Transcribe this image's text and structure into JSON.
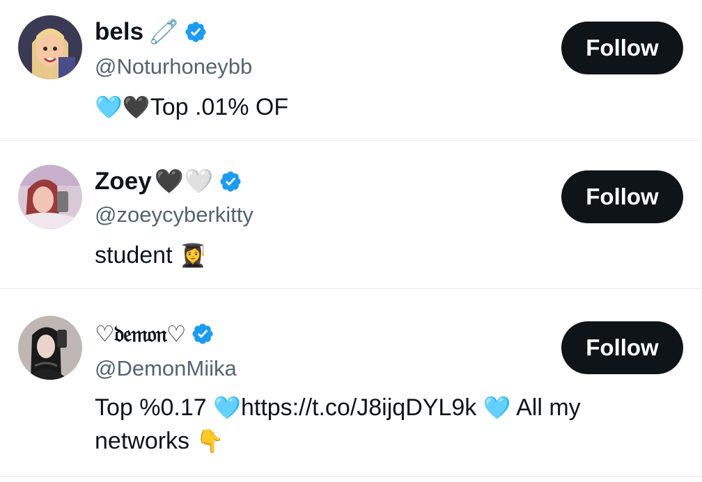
{
  "accounts": [
    {
      "name": "bels",
      "name_emoji": "🧷",
      "handle": "@Noturhoneybb",
      "bio_prefix": "🩵🖤",
      "bio": "Top .01% OF",
      "follow_label": "Follow",
      "verified": true
    },
    {
      "name": "Zoey",
      "name_emoji": "🖤🤍",
      "handle": "@zoeycyberkitty",
      "bio": "student",
      "bio_suffix": "👩‍🎓",
      "follow_label": "Follow",
      "verified": true
    },
    {
      "name": "♡𝔡𝔢𝔪𝔬𝔫♡",
      "handle": "@DemonMiika",
      "bio_part1": "Top %0.17 ",
      "bio_heart1": "🩵",
      "bio_part2": "https://t.co/J8ijqDYL9k ",
      "bio_heart2": "🩵",
      "bio_part3": " All my networks ",
      "bio_point": "👇",
      "follow_label": "Follow",
      "verified": true
    }
  ],
  "colors": {
    "verified_blue": "#1d9bf0",
    "follow_bg": "#0f1419",
    "handle_gray": "#536471",
    "divider": "#eff3f4"
  }
}
